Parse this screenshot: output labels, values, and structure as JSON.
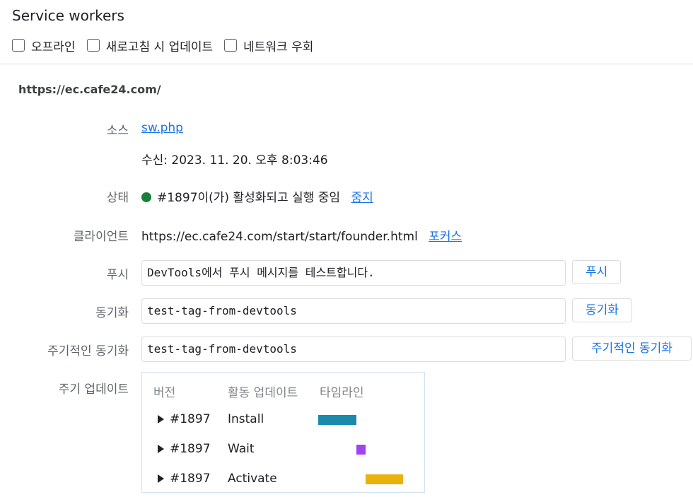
{
  "header": {
    "title": "Service workers",
    "options": [
      {
        "label": "오프라인",
        "checked": false
      },
      {
        "label": "새로고침 시 업데이트",
        "checked": false
      },
      {
        "label": "네트워크 우회",
        "checked": false
      }
    ]
  },
  "worker": {
    "origin": "https://ec.cafe24.com/",
    "source": {
      "label": "소스",
      "file": "sw.php",
      "received": "수신: 2023. 11. 20. 오후 8:03:46"
    },
    "status": {
      "label": "상태",
      "text": "#1897이(가) 활성화되고 실행 중임",
      "stop_link": "중지",
      "dot_color": "#188038"
    },
    "clients": {
      "label": "클라이언트",
      "url": "https://ec.cafe24.com/start/start/founder.html",
      "focus_link": "포커스"
    },
    "push": {
      "label": "푸시",
      "value": "DevTools에서 푸시 메시지를 테스트합니다.",
      "button": "푸시"
    },
    "sync": {
      "label": "동기화",
      "value": "test-tag-from-devtools",
      "button": "동기화"
    },
    "periodic_sync": {
      "label": "주기적인 동기화",
      "value": "test-tag-from-devtools",
      "button": "주기적인 동기화"
    },
    "update_cycle": {
      "label": "주기 업데이트",
      "headers": {
        "version": "버전",
        "activity": "활동 업데이트",
        "timeline": "타임라인"
      },
      "rows": [
        {
          "version": "#1897",
          "event": "Install",
          "color": "#1a8bab"
        },
        {
          "version": "#1897",
          "event": "Wait",
          "color": "#a142f4"
        },
        {
          "version": "#1897",
          "event": "Activate",
          "color": "#e9b20c"
        }
      ]
    }
  }
}
